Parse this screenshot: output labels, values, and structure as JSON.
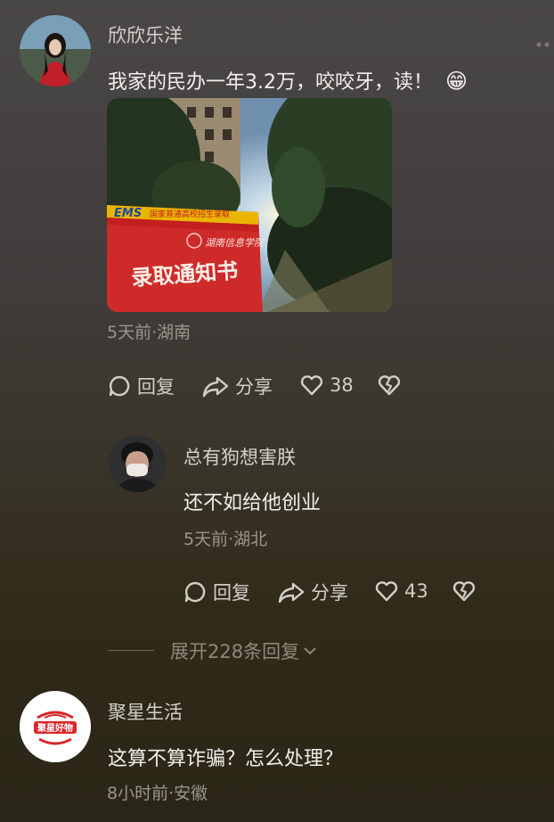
{
  "comments": [
    {
      "author": "欣欣乐洋",
      "text": "我家的民办一年3.2万，咬咬牙，读！",
      "emoji": "😁",
      "meta": "5天前·湖南",
      "image": {
        "banner_brand": "EMS",
        "banner_top": "国家普通高校招生录取",
        "banner_school": "湖南信息学院",
        "banner_main": "录取通知书"
      },
      "actions": {
        "reply": "回复",
        "share": "分享",
        "likes": "38"
      }
    },
    {
      "author": "总有狗想害朕",
      "text": "还不如给他创业",
      "meta": "5天前·湖北",
      "actions": {
        "reply": "回复",
        "share": "分享",
        "likes": "43"
      }
    },
    {
      "author": "聚星生活",
      "text": "这算不算诈骗？怎么处理？",
      "meta": "8小时前·安徽",
      "avatar_text": "聚星好物"
    }
  ],
  "expand": {
    "label": "展开228条回复"
  },
  "icons": [
    "more-icon",
    "reply-icon",
    "share-icon",
    "like-icon",
    "dislike-icon",
    "chevron-down-icon"
  ]
}
